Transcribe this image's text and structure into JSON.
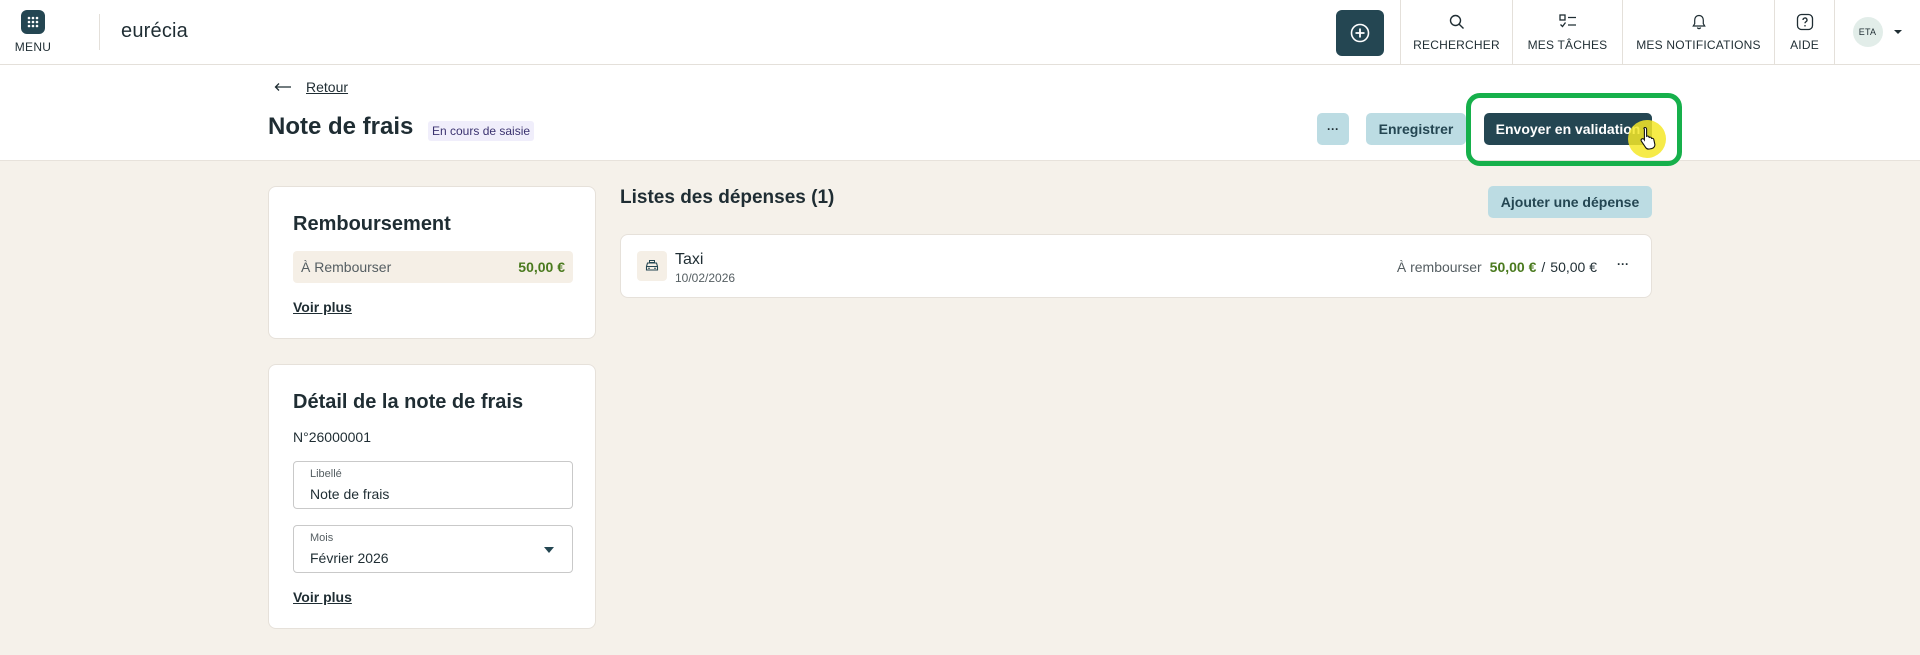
{
  "topbar": {
    "menu_label": "MENU",
    "logo_text": "eurécia",
    "nav": {
      "search": "RECHERCHER",
      "tasks": "MES TÂCHES",
      "notifications": "MES NOTIFICATIONS",
      "help": "AIDE",
      "avatar_initials": "ETA"
    }
  },
  "header": {
    "back_label": "Retour",
    "title": "Note de frais",
    "status": "En cours de saisie",
    "more_label": "···",
    "save_label": "Enregistrer",
    "send_label": "Envoyer en validation"
  },
  "reimbursement": {
    "title": "Remboursement",
    "row_label": "À Rembourser",
    "row_amount": "50,00 €",
    "more_link": "Voir plus"
  },
  "detail": {
    "title": "Détail de la note de frais",
    "number": "N°26000001",
    "label_field": {
      "label": "Libellé",
      "value": "Note de frais"
    },
    "month_field": {
      "label": "Mois",
      "value": "Février 2026"
    },
    "more_link": "Voir plus"
  },
  "expenses": {
    "title": "Listes des dépenses (1)",
    "add_label": "Ajouter une dépense",
    "items": [
      {
        "name": "Taxi",
        "date": "10/02/2026",
        "due_label": "À rembourser",
        "amount": "50,00 €",
        "separator": "/",
        "total": "50,00 €",
        "more": "···"
      }
    ]
  },
  "colors": {
    "primary": "#244652",
    "secondary_button": "#bcdce3",
    "background": "#f5f1ea",
    "amount_green": "#4a7a1e",
    "highlight": "#16b04b"
  },
  "icons": [
    "grid-icon",
    "plus-circle-icon",
    "search-icon",
    "task-list-icon",
    "bell-icon",
    "help-icon",
    "chevron-down-icon",
    "arrow-left-icon",
    "taxi-icon",
    "pointer-cursor-icon"
  ]
}
